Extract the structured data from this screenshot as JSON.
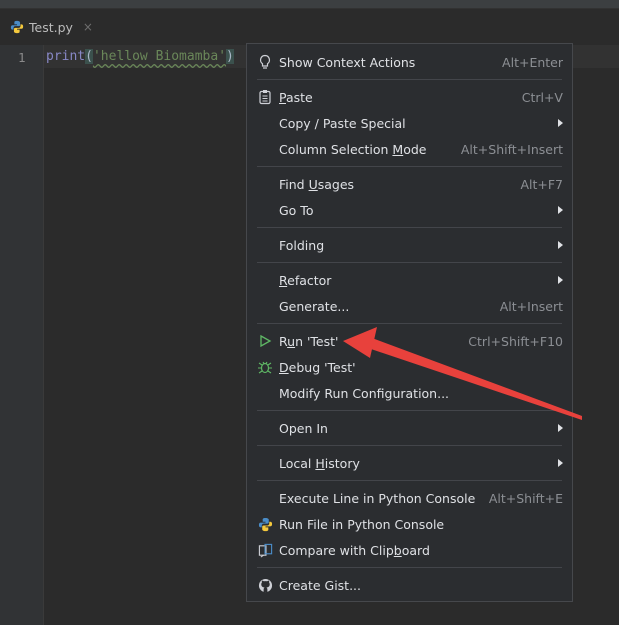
{
  "tab": {
    "filename": "Test.py",
    "close": "×",
    "icon": "python-file-icon"
  },
  "editor": {
    "line_number": "1",
    "code": {
      "fn": "print",
      "open": "(",
      "string": "'hellow Biomamba'",
      "close": ")"
    }
  },
  "menu": {
    "groups": [
      [
        {
          "pre": "Show Context Actions",
          "mn": "",
          "post": "",
          "shortcut": "Alt+Enter",
          "icon": "lightbulb-icon"
        }
      ],
      [
        {
          "pre": "",
          "mn": "P",
          "post": "aste",
          "shortcut": "Ctrl+V",
          "icon": "clipboard-icon"
        },
        {
          "pre": "Copy / Paste Special",
          "mn": "",
          "post": "",
          "submenu": true
        },
        {
          "pre": "Column Selection ",
          "mn": "M",
          "post": "ode",
          "shortcut": "Alt+Shift+Insert"
        }
      ],
      [
        {
          "pre": "Find ",
          "mn": "U",
          "post": "sages",
          "shortcut": "Alt+F7"
        },
        {
          "pre": "Go To",
          "mn": "",
          "post": "",
          "submenu": true
        }
      ],
      [
        {
          "pre": "Folding",
          "mn": "",
          "post": "",
          "submenu": true
        }
      ],
      [
        {
          "pre": "",
          "mn": "R",
          "post": "efactor",
          "submenu": true
        },
        {
          "pre": "Generate...",
          "mn": "",
          "post": "",
          "shortcut": "Alt+Insert"
        }
      ],
      [
        {
          "pre": "R",
          "mn": "u",
          "post": "n 'Test'",
          "shortcut": "Ctrl+Shift+F10",
          "icon": "run-icon"
        },
        {
          "pre": "",
          "mn": "D",
          "post": "ebug 'Test'",
          "icon": "debug-icon"
        },
        {
          "pre": "Modify Run Configuration...",
          "mn": "",
          "post": ""
        }
      ],
      [
        {
          "pre": "Open In",
          "mn": "",
          "post": "",
          "submenu": true
        }
      ],
      [
        {
          "pre": "Local ",
          "mn": "H",
          "post": "istory",
          "submenu": true
        }
      ],
      [
        {
          "pre": "Execute Line in Python Console",
          "mn": "",
          "post": "",
          "shortcut": "Alt+Shift+E"
        },
        {
          "pre": "Run File in Python Console",
          "mn": "",
          "post": "",
          "icon": "python-icon"
        },
        {
          "pre": "Compare with Clip",
          "mn": "b",
          "post": "oard",
          "icon": "compare-icon"
        }
      ],
      [
        {
          "pre": "Create Gist...",
          "mn": "",
          "post": "",
          "icon": "github-icon"
        }
      ]
    ]
  },
  "annotation": {
    "color": "#e8413c"
  }
}
